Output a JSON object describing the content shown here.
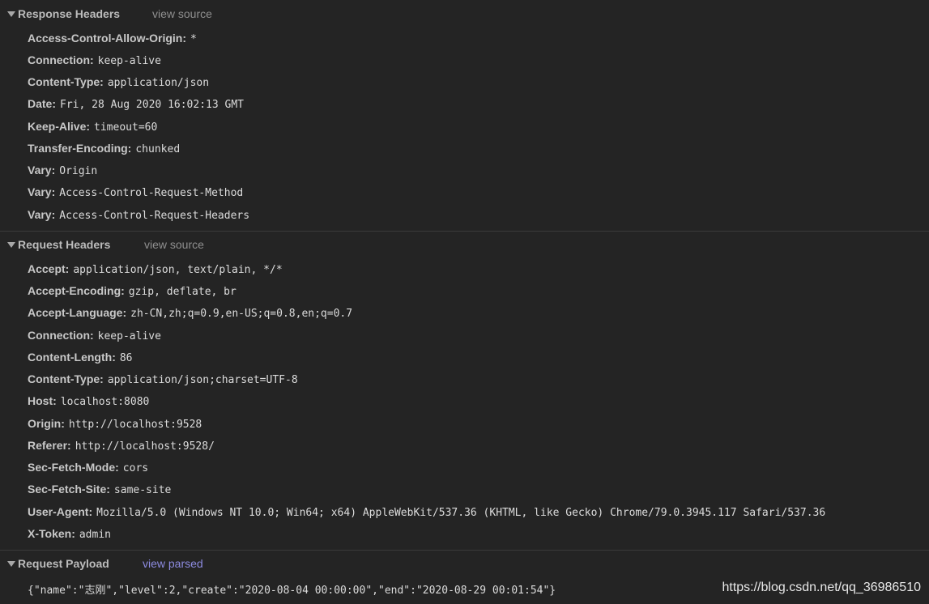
{
  "response_headers": {
    "title": "Response Headers",
    "view_link": "view source",
    "items": [
      {
        "name": "Access-Control-Allow-Origin:",
        "value": "*"
      },
      {
        "name": "Connection:",
        "value": "keep-alive"
      },
      {
        "name": "Content-Type:",
        "value": "application/json"
      },
      {
        "name": "Date:",
        "value": "Fri, 28 Aug 2020 16:02:13 GMT"
      },
      {
        "name": "Keep-Alive:",
        "value": "timeout=60"
      },
      {
        "name": "Transfer-Encoding:",
        "value": "chunked"
      },
      {
        "name": "Vary:",
        "value": "Origin"
      },
      {
        "name": "Vary:",
        "value": "Access-Control-Request-Method"
      },
      {
        "name": "Vary:",
        "value": "Access-Control-Request-Headers"
      }
    ]
  },
  "request_headers": {
    "title": "Request Headers",
    "view_link": "view source",
    "items": [
      {
        "name": "Accept:",
        "value": "application/json, text/plain, */*"
      },
      {
        "name": "Accept-Encoding:",
        "value": "gzip, deflate, br"
      },
      {
        "name": "Accept-Language:",
        "value": "zh-CN,zh;q=0.9,en-US;q=0.8,en;q=0.7"
      },
      {
        "name": "Connection:",
        "value": "keep-alive"
      },
      {
        "name": "Content-Length:",
        "value": "86"
      },
      {
        "name": "Content-Type:",
        "value": "application/json;charset=UTF-8"
      },
      {
        "name": "Host:",
        "value": "localhost:8080"
      },
      {
        "name": "Origin:",
        "value": "http://localhost:9528"
      },
      {
        "name": "Referer:",
        "value": "http://localhost:9528/"
      },
      {
        "name": "Sec-Fetch-Mode:",
        "value": "cors"
      },
      {
        "name": "Sec-Fetch-Site:",
        "value": "same-site"
      },
      {
        "name": "User-Agent:",
        "value": "Mozilla/5.0 (Windows NT 10.0; Win64; x64) AppleWebKit/537.36 (KHTML, like Gecko) Chrome/79.0.3945.117 Safari/537.36"
      },
      {
        "name": "X-Token:",
        "value": "admin"
      }
    ]
  },
  "request_payload": {
    "title": "Request Payload",
    "view_link": "view parsed",
    "body": "{\"name\":\"志刚\",\"level\":2,\"create\":\"2020-08-04 00:00:00\",\"end\":\"2020-08-29 00:01:54\"}"
  },
  "watermark": "https://blog.csdn.net/qq_36986510",
  "colors": {
    "background": "#242424",
    "header_name": "#c8c8c8",
    "value_text": "#dcdcdc",
    "view_source": "#8f8f8f",
    "view_parsed": "#8d8be0"
  },
  "icons": {
    "section_toggle": "caret-down-icon"
  }
}
